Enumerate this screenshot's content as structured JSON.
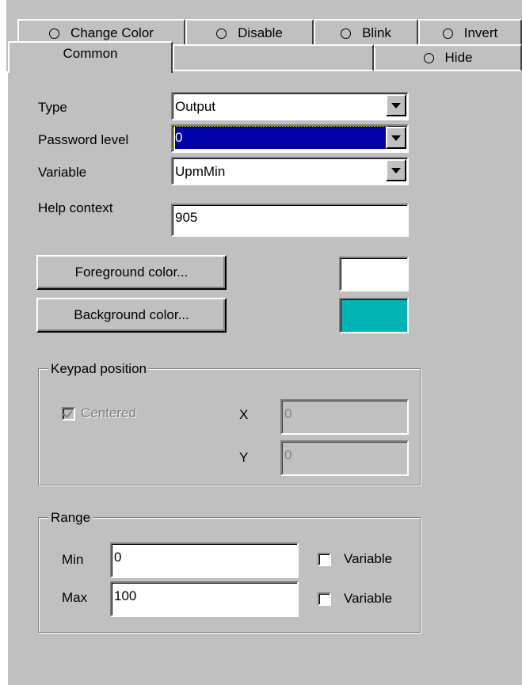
{
  "tabs": {
    "row_back": [
      {
        "label": "Change Color"
      },
      {
        "label": "Disable"
      },
      {
        "label": "Blink"
      },
      {
        "label": "Invert"
      }
    ],
    "common": "Common",
    "hide": "Hide"
  },
  "form": {
    "type_label": "Type",
    "type_value": "Output",
    "password_label": "Password level",
    "password_value": "0",
    "variable_label": "Variable",
    "variable_value": "UpmMin",
    "help_label": "Help context",
    "help_value": "905"
  },
  "colors": {
    "fg_button": "Foreground color...",
    "bg_button": "Background color...",
    "fg_swatch": "#ffffff",
    "bg_swatch": "#00b4b4"
  },
  "keypad": {
    "title": "Keypad position",
    "centered_label": "Centered",
    "centered_checked": true,
    "x_label": "X",
    "x_value": "0",
    "y_label": "Y",
    "y_value": "0"
  },
  "range": {
    "title": "Range",
    "min_label": "Min",
    "min_value": "0",
    "max_label": "Max",
    "max_value": "100",
    "min_variable_label": "Variable",
    "max_variable_label": "Variable"
  }
}
